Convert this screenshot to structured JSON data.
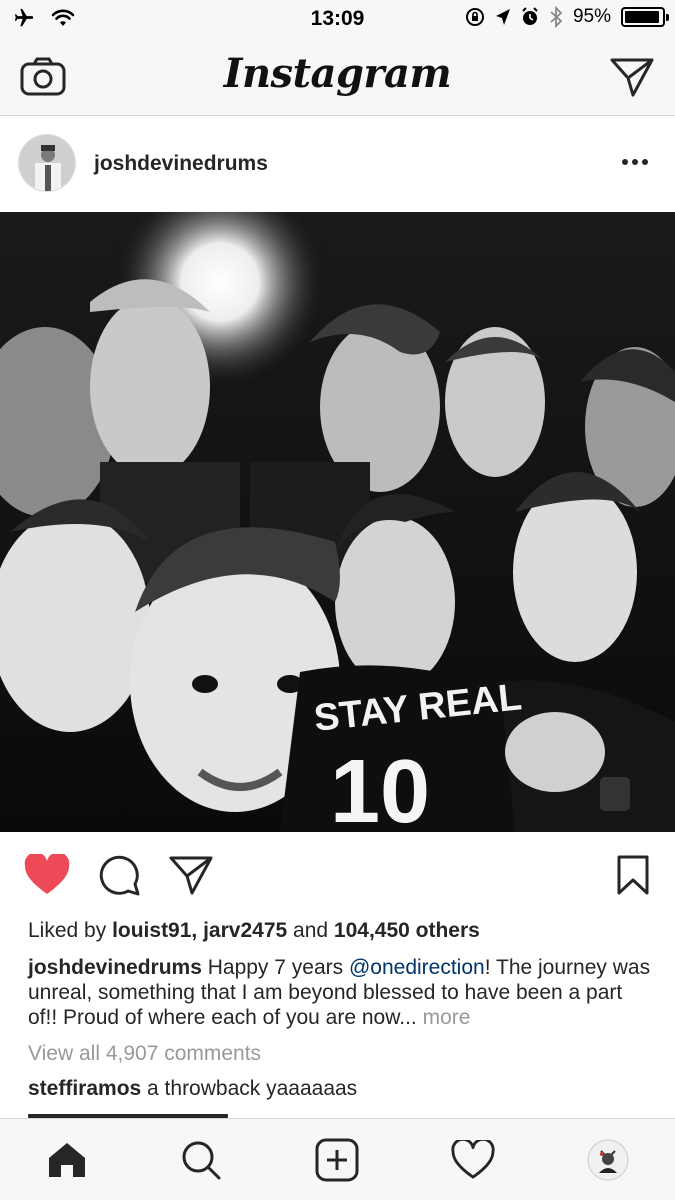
{
  "status_bar": {
    "time": "13:09",
    "battery_percent_text": "95%",
    "battery_level": 0.95,
    "icons": [
      "airplane-icon",
      "wifi-icon",
      "orientation-lock-icon",
      "location-icon",
      "alarm-icon",
      "bluetooth-icon",
      "battery-icon"
    ]
  },
  "nav": {
    "title": "Instagram",
    "left_icon": "camera-icon",
    "right_icon": "direct-send-icon"
  },
  "post": {
    "username": "joshdevinedrums",
    "options_icon": "more-options-icon",
    "likes": {
      "prefix": "Liked by ",
      "user1": "louist91",
      "sep": ", ",
      "user2": "jarv2475",
      "and": " and ",
      "others": "104,450 others"
    },
    "caption": {
      "username": "joshdevinedrums",
      "text_before": " Happy 7 years ",
      "mention": "@onedirection",
      "text_after": "! The journey was unreal, something that I am beyond blessed to have been a part of!! Proud of where each of you are now...",
      "more": " more"
    },
    "view_all_comments": "View all 4,907 comments",
    "comments": [
      {
        "username": "steffiramos",
        "text": " a throwback yaaaaaas"
      }
    ],
    "liked": true,
    "photo_shirt_text": "STAY REAL",
    "photo_shirt_number": "10",
    "colors": {
      "like_red": "#ed4956",
      "mention_blue": "#003569",
      "muted_gray": "#999999"
    }
  },
  "tab_bar": {
    "tabs": [
      "home-icon",
      "search-icon",
      "new-post-icon",
      "activity-heart-icon",
      "profile-avatar"
    ],
    "active": "home-icon"
  }
}
